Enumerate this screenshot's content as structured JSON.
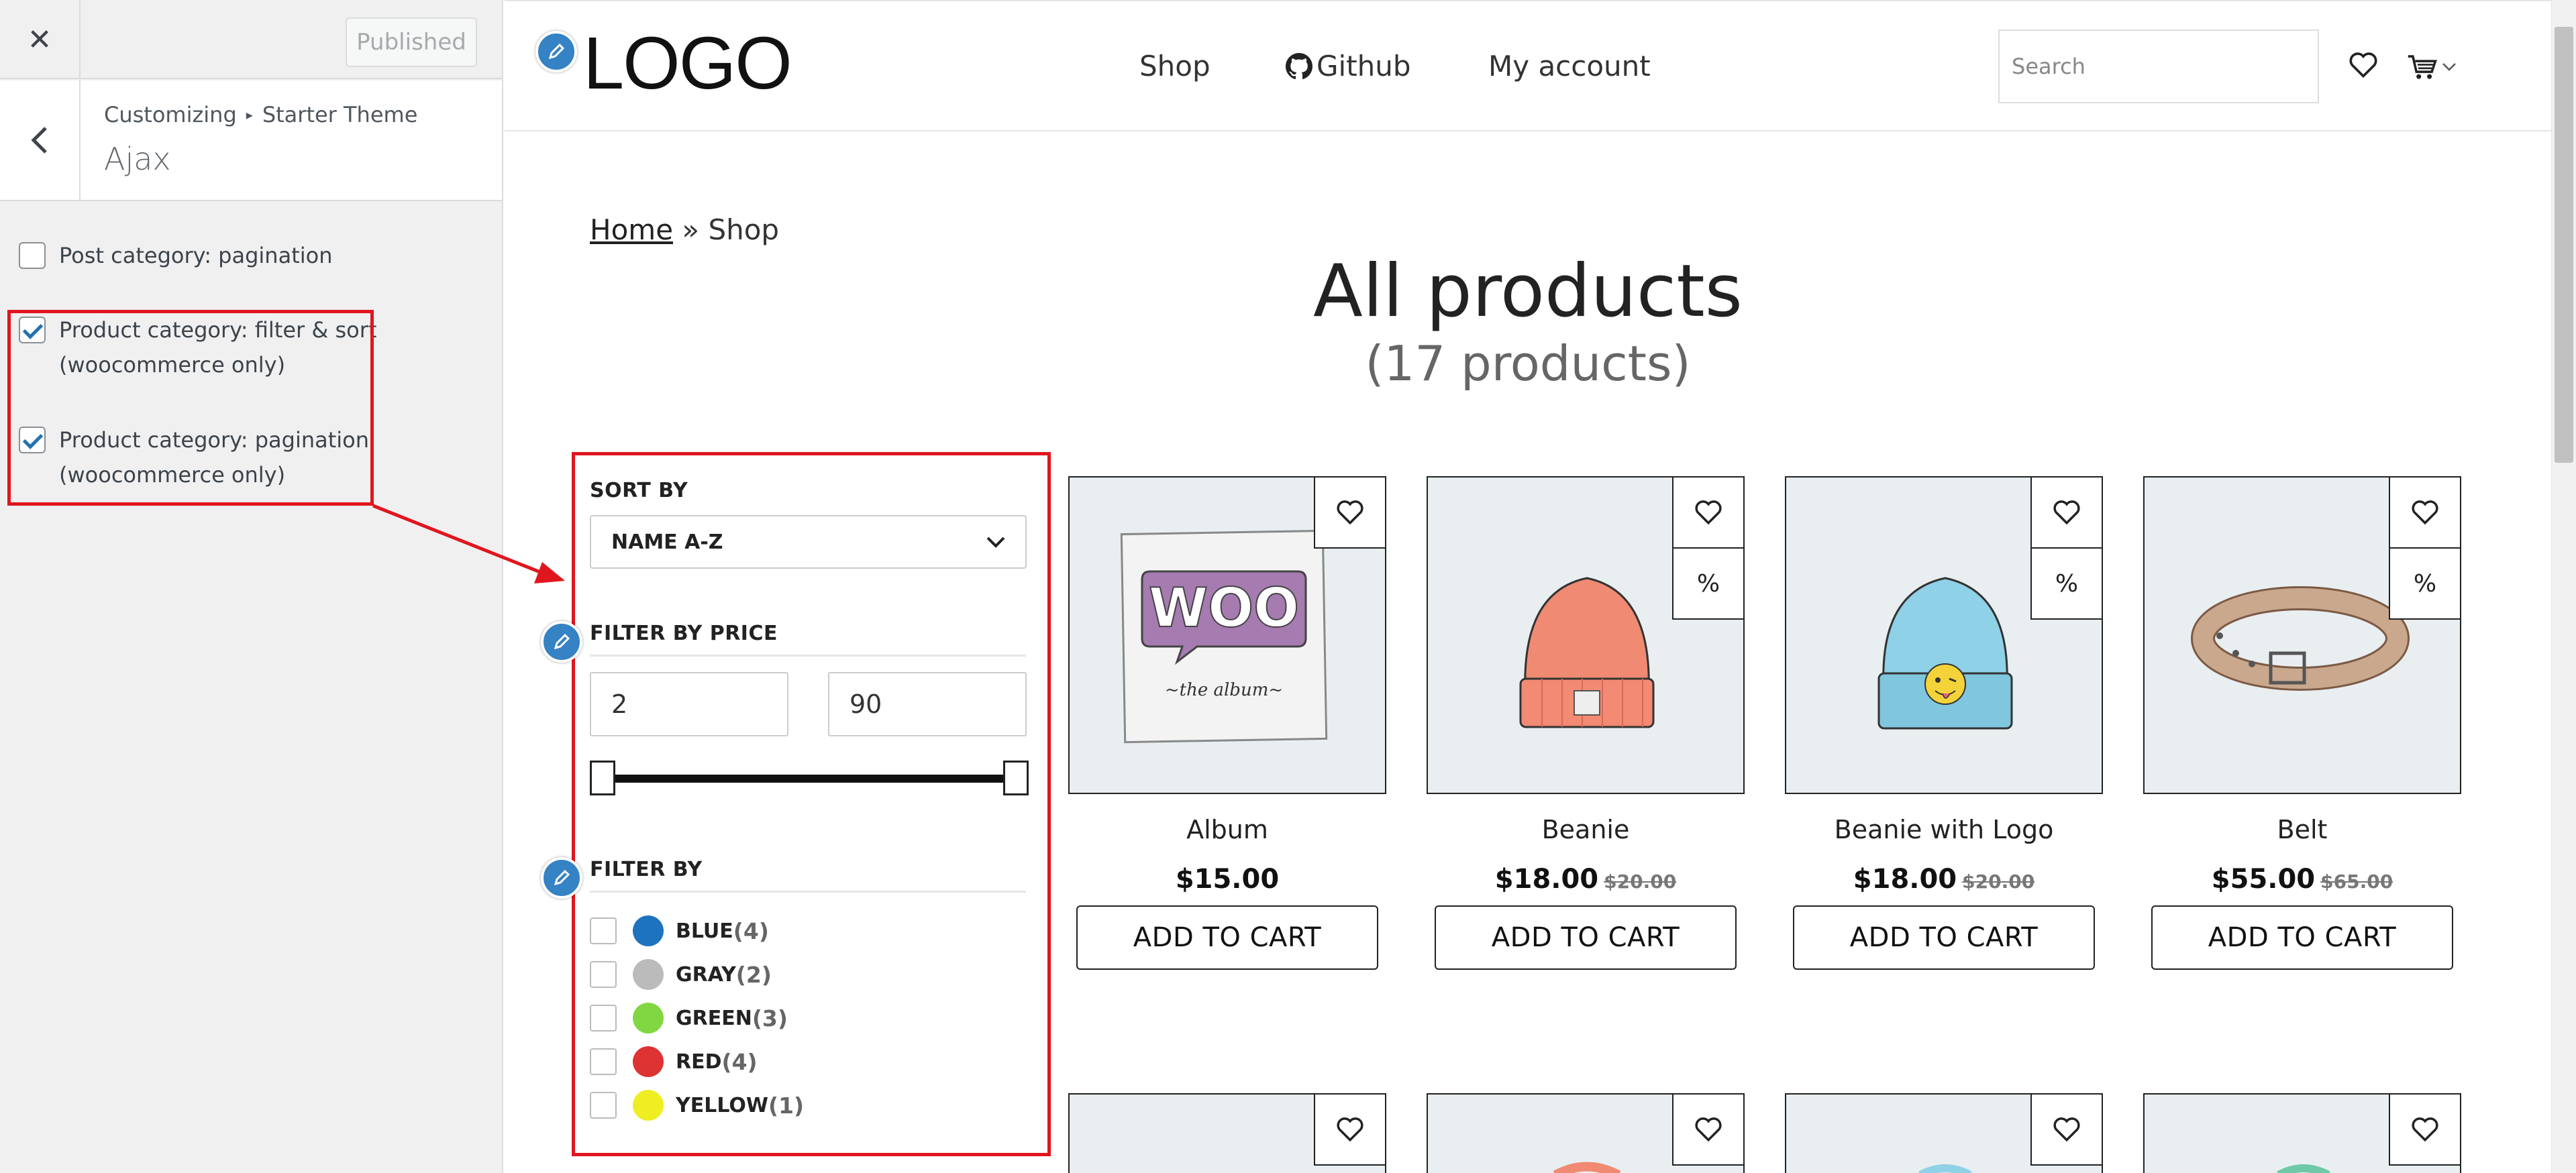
{
  "customizer": {
    "close_icon": "close-icon",
    "publish_label": "Published",
    "breadcrumb": [
      "Customizing",
      "Starter Theme"
    ],
    "section_title": "Ajax",
    "options": [
      {
        "label": "Post category: pagination",
        "checked": false
      },
      {
        "label_line1": "Product category: filter & sort",
        "label_line2": "(woocommerce only)",
        "checked": true
      },
      {
        "label_line1": "Product category: pagination",
        "label_line2": "(woocommerce only)",
        "checked": true
      }
    ],
    "annotation_color": "#e0161e"
  },
  "site": {
    "logo": "LOGO",
    "nav": {
      "shop": "Shop",
      "github": "Github",
      "account": "My account"
    },
    "search_placeholder": "Search",
    "breadcrumb": {
      "home": "Home",
      "sep": " » ",
      "current": "Shop"
    },
    "title": "All products",
    "count": "(17 products)"
  },
  "filters": {
    "sort_label": "SORT BY",
    "sort_value": "NAME A-Z",
    "price_label": "FILTER BY PRICE",
    "price_min": "2",
    "price_max": "90",
    "filter_label": "FILTER BY",
    "colors": [
      {
        "name": "BLUE",
        "count": "(4)",
        "hex": "#1e73be"
      },
      {
        "name": "GRAY",
        "count": "(2)",
        "hex": "#bbbbbb"
      },
      {
        "name": "GREEN",
        "count": "(3)",
        "hex": "#81d742"
      },
      {
        "name": "RED",
        "count": "(4)",
        "hex": "#dd3333"
      },
      {
        "name": "YELLOW",
        "count": "(1)",
        "hex": "#eeee22"
      }
    ]
  },
  "products": [
    {
      "name": "Album",
      "price": "$15.00",
      "old_price": "",
      "cta": "ADD TO CART",
      "sale_badge": ""
    },
    {
      "name": "Beanie",
      "price": "$18.00",
      "old_price": "$20.00",
      "cta": "ADD TO CART",
      "sale_badge": "%"
    },
    {
      "name": "Beanie with Logo",
      "price": "$18.00",
      "old_price": "$20.00",
      "cta": "ADD TO CART",
      "sale_badge": "%"
    },
    {
      "name": "Belt",
      "price": "$55.00",
      "old_price": "$65.00",
      "cta": "ADD TO CART",
      "sale_badge": "%"
    }
  ],
  "icons": {
    "wishlist": "heart-icon",
    "cart": "cart-icon",
    "edit": "pencil-icon",
    "github": "github-icon"
  }
}
